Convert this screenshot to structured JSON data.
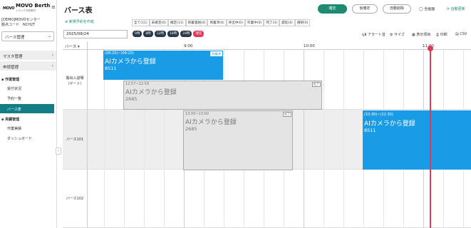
{
  "sidebar": {
    "logo_mark": "MOVO",
    "title": "MOVO Berth",
    "subtitle": "トラック予約受付",
    "center_name": "[DEMO]MOVOセンター",
    "center_code": "拠点コード　NCH2T",
    "mode": "バース管理",
    "menu": {
      "master": "マスタ管理",
      "application": "申請管理"
    },
    "work_section": "作業管理",
    "work_items": [
      "受付状況",
      "予約一覧",
      "バース表"
    ],
    "results_section": "実績管理",
    "results_items": [
      "作業実績",
      "ダッシュボード"
    ]
  },
  "header": {
    "title": "バース表",
    "confirm_btn": "確定",
    "tentative_btn": "仮確定",
    "autodel_btn": "自動削除",
    "fullscreen": "全画面",
    "autorefresh": "自動更新",
    "new_reservation": "新規予約を作成"
  },
  "filters": [
    "全て(11)",
    "未確定(0)",
    "確定(11)",
    "到着連絡(0)",
    "到着済(4)",
    "呼出中(0)",
    "作業中(0)",
    "完了(3)",
    "遅延(4)",
    "選択(0)"
  ],
  "date": "2025/08/24",
  "zoom": [
    "0時",
    "8時",
    "12時",
    "18時",
    "24時",
    "現在"
  ],
  "tools": {
    "alert": "アラート音",
    "size": "サイズ",
    "view_settings": "表示項目",
    "print": "印刷",
    "csv": "CSV"
  },
  "grid": {
    "berth_header": "バース",
    "times": [
      "9:00",
      "10:00",
      "11:00"
    ],
    "rows": [
      "搬出入退場\n（ゲート）",
      "バース101",
      "バース102"
    ]
  },
  "blocks": [
    {
      "time": "(08:20)~(09:20)",
      "title": "AIカメラから登録",
      "number": "8511",
      "status": "到着済",
      "style": "blue"
    },
    {
      "time": "12:57~12:58",
      "title": "AIカメラから登録",
      "number": "2685",
      "status": "完了",
      "style": "gray"
    },
    {
      "time": "13:00~13:00",
      "title": "AIカメラから登録",
      "number": "2685",
      "status": "完了",
      "style": "gray"
    },
    {
      "time": "(10:30)~(11:30)",
      "title": "AIカメラから登録",
      "number": "8511",
      "status": "",
      "style": "blue"
    }
  ],
  "colors": {
    "primary": "#1d8a71",
    "active_nav": "#127d84",
    "block_blue": "#1a9be6",
    "now_line": "#e03a59"
  }
}
